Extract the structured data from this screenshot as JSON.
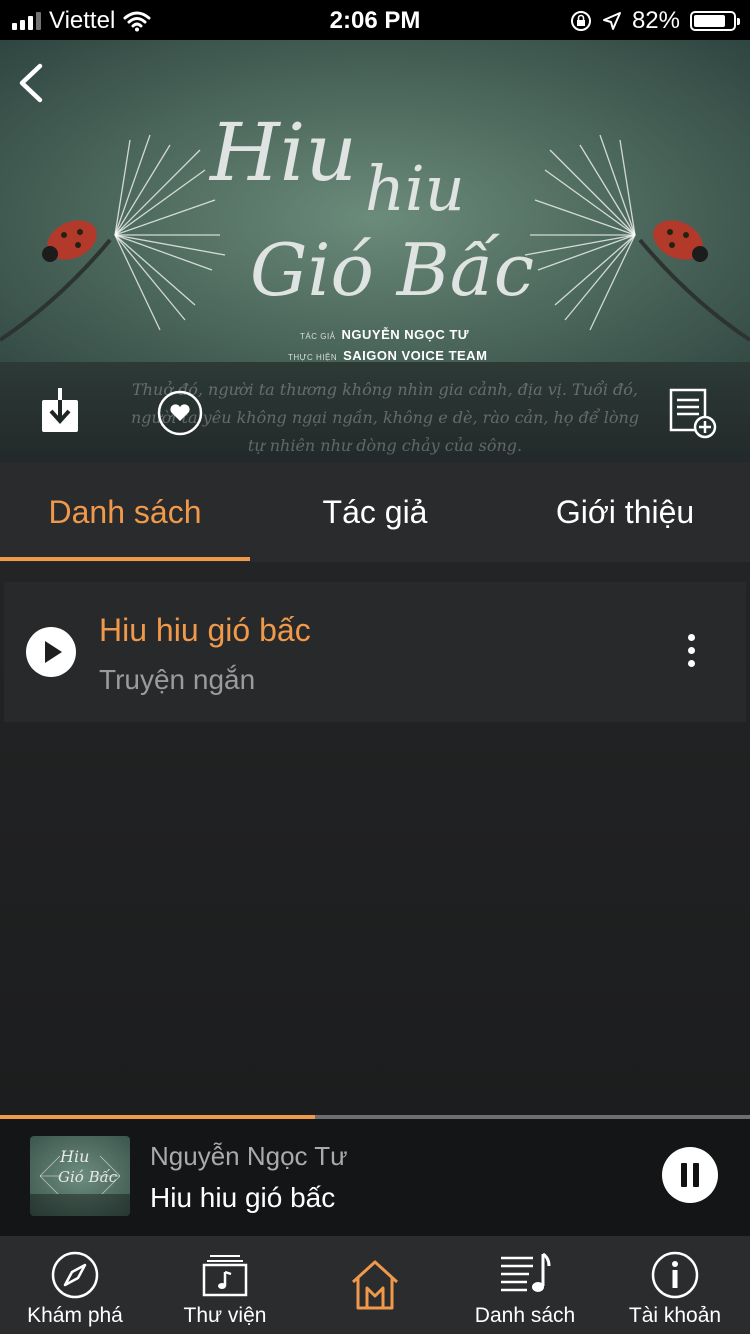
{
  "status_bar": {
    "carrier": "Viettel",
    "time": "2:06 PM",
    "battery_percent": "82%",
    "battery_level": 0.82
  },
  "cover": {
    "title_line1": "Hiu",
    "title_line2": "hiu",
    "title_line3": "Gió Bấc",
    "author_caption": "TÁC GIẢ",
    "author_name": "NGUYỄN NGỌC TƯ",
    "producer_caption": "THỰC HIỆN",
    "producer_name": "SAIGON VOICE TEAM",
    "quote": "Thuở đó, người ta thương không nhìn gia cảnh, địa vị. Tuổi đó, người ta yêu không ngại ngần, không e dè, rào cản, họ để lòng tự nhiên như dòng chảy của sông."
  },
  "tabs": [
    {
      "label": "Danh sách",
      "active": true
    },
    {
      "label": "Tác giả",
      "active": false
    },
    {
      "label": "Giới thiệu",
      "active": false
    }
  ],
  "episodes": [
    {
      "title": "Hiu hiu gió bấc",
      "subtitle": "Truyện ngắn"
    }
  ],
  "player": {
    "author": "Nguyễn Ngọc Tư",
    "title": "Hiu hiu gió bấc",
    "progress": 0.42
  },
  "nav": [
    {
      "label": "Khám phá",
      "icon": "compass-icon"
    },
    {
      "label": "Thư viện",
      "icon": "library-icon"
    },
    {
      "label": "",
      "icon": "home-icon",
      "active": true
    },
    {
      "label": "Danh sách",
      "icon": "playlist-icon"
    },
    {
      "label": "Tài khoản",
      "icon": "info-icon"
    }
  ],
  "colors": {
    "accent": "#f0994a",
    "background": "#1f2021",
    "tab_bar": "#2a2b2c"
  }
}
